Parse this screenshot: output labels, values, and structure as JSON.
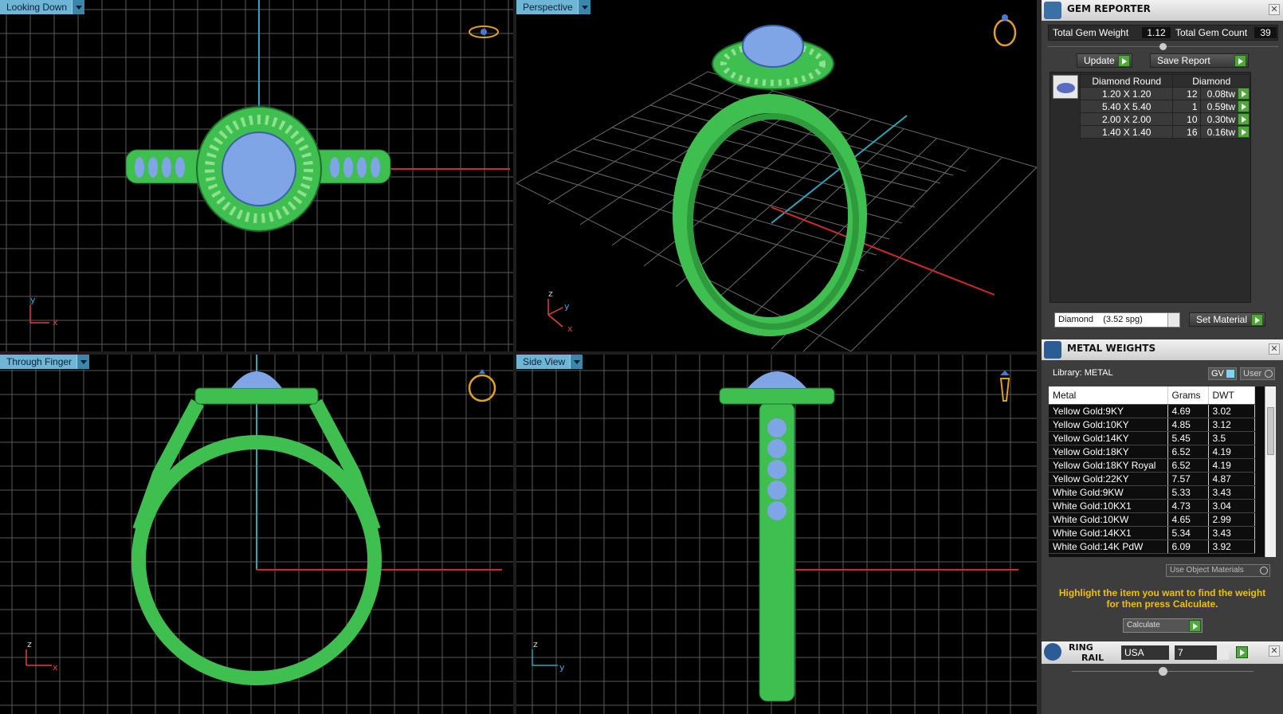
{
  "viewports": {
    "top_left": {
      "label": "Looking Down",
      "axis_a": "y",
      "axis_b": "x"
    },
    "top_right": {
      "label": "Perspective",
      "axis_a": "z",
      "axis_b": "y",
      "axis_c": "x"
    },
    "bottom_left": {
      "label": "Through Finger",
      "axis_a": "z",
      "axis_b": "x"
    },
    "bottom_right": {
      "label": "Side View",
      "axis_a": "z",
      "axis_b": "y"
    }
  },
  "gem_reporter": {
    "title": "GEM REPORTER",
    "total_weight_label": "Total Gem Weight",
    "total_weight_value": "1.12",
    "total_count_label": "Total Gem Count",
    "total_count_value": "39",
    "update_label": "Update",
    "save_label": "Save Report",
    "table_headers": [
      "Diamond Round",
      "Diamond"
    ],
    "rows": [
      {
        "size": "1.20 X 1.20",
        "count": "12",
        "weight": "0.08tw"
      },
      {
        "size": "5.40 X 5.40",
        "count": "1",
        "weight": "0.59tw"
      },
      {
        "size": "2.00 X 2.00",
        "count": "10",
        "weight": "0.30tw"
      },
      {
        "size": "1.40 X 1.40",
        "count": "16",
        "weight": "0.16tw"
      }
    ],
    "material_select": "Diamond    (3.52 spg)",
    "set_material_label": "Set Material"
  },
  "metal_weights": {
    "title": "METAL WEIGHTS",
    "library_label": "Library: METAL",
    "gv_label": "GV",
    "user_label": "User",
    "headers": [
      "Metal",
      "Grams",
      "DWT"
    ],
    "rows": [
      {
        "metal": "Yellow Gold:9KY",
        "grams": "4.69",
        "dwt": "3.02"
      },
      {
        "metal": "Yellow Gold:10KY",
        "grams": "4.85",
        "dwt": "3.12"
      },
      {
        "metal": "Yellow Gold:14KY",
        "grams": "5.45",
        "dwt": "3.5"
      },
      {
        "metal": "Yellow Gold:18KY",
        "grams": "6.52",
        "dwt": "4.19"
      },
      {
        "metal": "Yellow Gold:18KY Royal",
        "grams": "6.52",
        "dwt": "4.19"
      },
      {
        "metal": "Yellow Gold:22KY",
        "grams": "7.57",
        "dwt": "4.87"
      },
      {
        "metal": "White Gold:9KW",
        "grams": "5.33",
        "dwt": "3.43"
      },
      {
        "metal": "White Gold:10KX1",
        "grams": "4.73",
        "dwt": "3.04"
      },
      {
        "metal": "White Gold:10KW",
        "grams": "4.65",
        "dwt": "2.99"
      },
      {
        "metal": "White Gold:14KX1",
        "grams": "5.34",
        "dwt": "3.43"
      },
      {
        "metal": "White Gold:14K PdW",
        "grams": "6.09",
        "dwt": "3.92"
      }
    ],
    "use_object_materials": "Use Object Materials",
    "hint": "Highlight the item you want to find the weight for then press Calculate.",
    "calculate_label": "Calculate"
  },
  "ring_rail": {
    "title_line1": "RING",
    "title_line2": "RAIL",
    "region": "USA",
    "size": "7"
  },
  "colors": {
    "ring": "#3fbf4f",
    "gem": "#7fa5e6",
    "grid": "#5a5a5a",
    "axis_cyan": "#2aa6b8",
    "axis_red": "#d02a2a",
    "accent_green": "#4fa93a",
    "hint_yellow": "#f0c000"
  }
}
